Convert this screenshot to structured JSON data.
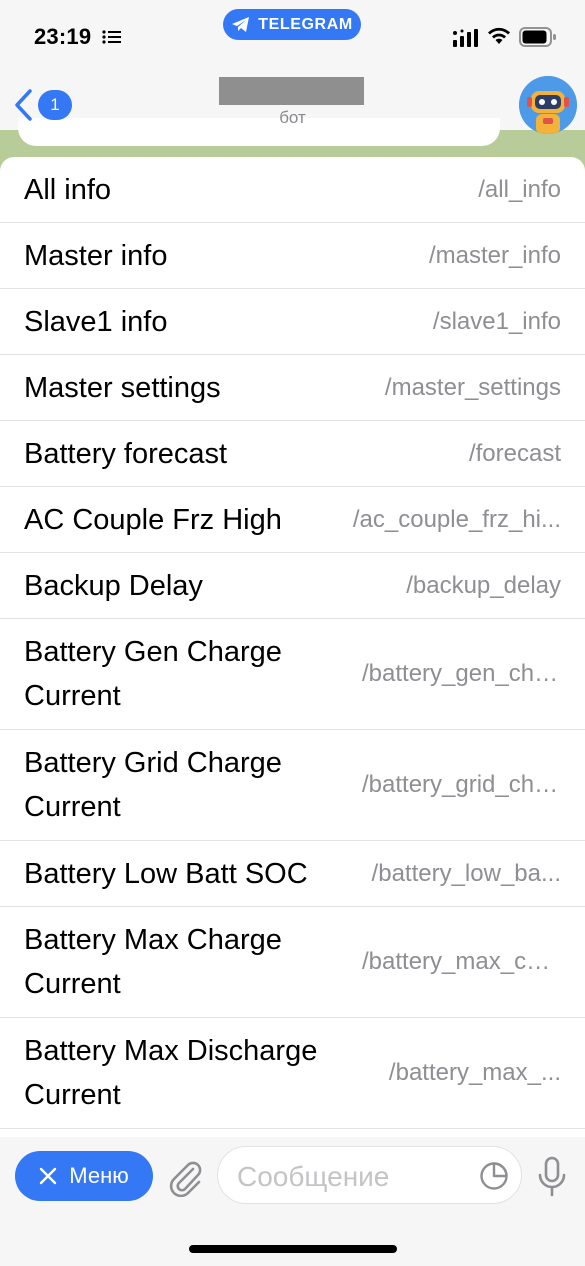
{
  "status_bar": {
    "time": "23:19",
    "app_pill": "TELEGRAM"
  },
  "header": {
    "back_count": "1",
    "subtitle": "бот",
    "title_redacted": true
  },
  "commands": [
    {
      "name": "All info",
      "code": "/all_info",
      "lines": 1
    },
    {
      "name": "Master info",
      "code": "/master_info",
      "lines": 1
    },
    {
      "name": "Slave1 info",
      "code": "/slave1_info",
      "lines": 1
    },
    {
      "name": "Master settings",
      "code": "/master_settings",
      "lines": 1
    },
    {
      "name": "Battery forecast",
      "code": "/forecast",
      "lines": 1
    },
    {
      "name": "AC Couple Frz High",
      "code": "/ac_couple_frz_hi...",
      "lines": 1
    },
    {
      "name": "Backup Delay",
      "code": "/backup_delay",
      "lines": 1
    },
    {
      "name": "Battery Gen Charge Current",
      "code": "/battery_gen_char...",
      "lines": 2
    },
    {
      "name": "Battery Grid Charge Current",
      "code": "/battery_grid_char...",
      "lines": 2
    },
    {
      "name": "Battery Low Batt SOC",
      "code": "/battery_low_ba...",
      "lines": 1
    },
    {
      "name": "Battery Max Charge Current",
      "code": "/battery_max_cha...",
      "lines": 2
    },
    {
      "name": "Battery Max Discharge Current",
      "code": "/battery_max_...",
      "lines": 2
    }
  ],
  "input_bar": {
    "menu_label": "Меню",
    "placeholder": "Сообщение"
  },
  "icons": {
    "back": "chevron-left-icon",
    "menu_close": "close-icon",
    "attach": "paperclip-icon",
    "sticker": "sticker-icon",
    "mic": "microphone-icon"
  },
  "colors": {
    "accent": "#3478f6",
    "secondary_text": "#8e8e93",
    "chat_background": "#b9cf9c"
  }
}
